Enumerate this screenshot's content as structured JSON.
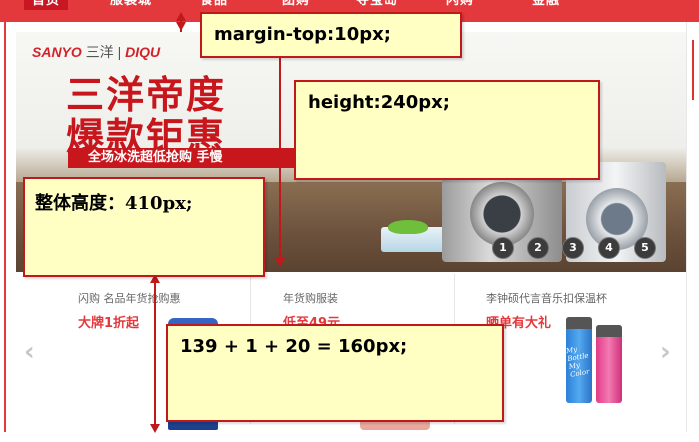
{
  "nav": {
    "items": [
      "首页",
      "服装城",
      "食品",
      "团购",
      "夺宝岛",
      "闪购",
      "金融"
    ]
  },
  "banner": {
    "brand": "SANYO",
    "brand_cn": "三洋",
    "brand_extra": "DIQU",
    "headline_1": "三洋帝度",
    "headline_2": "爆款钜惠",
    "subline": "全场冰洗超低抢购 手慢",
    "slides": [
      "1",
      "2",
      "3",
      "4",
      "5"
    ]
  },
  "promos": [
    {
      "small": "闪购   名品年货抢购惠",
      "big": "大牌1折起"
    },
    {
      "small": "年货购服装",
      "big": "低至49元"
    },
    {
      "small": "李钟硕代言音乐扣保温杯",
      "big": "晒单有大礼"
    }
  ],
  "bottle_text": "My Bottle My Color",
  "annotations": {
    "margin_top": "margin-top:10px;",
    "height": "height:240px;",
    "total_height": "整体高度：410px;",
    "sum": "139 + 1 + 20 = 160px;"
  },
  "colors": {
    "accent_red": "#e4393c",
    "note_bg": "#ffffc4",
    "note_border": "#c0181b"
  }
}
